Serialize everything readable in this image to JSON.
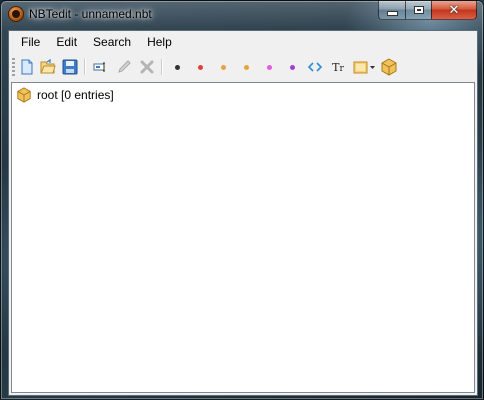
{
  "window": {
    "title": "NBTedit - unnamed.nbt"
  },
  "menu": [
    {
      "label": "File"
    },
    {
      "label": "Edit"
    },
    {
      "label": "Search"
    },
    {
      "label": "Help"
    }
  ],
  "toolbar": {
    "buttons": [
      {
        "icon": "new-file-icon"
      },
      {
        "icon": "open-folder-icon"
      },
      {
        "icon": "save-icon"
      },
      {
        "icon": "rename-icon"
      },
      {
        "icon": "edit-pencil-icon",
        "disabled": true
      },
      {
        "icon": "delete-icon",
        "disabled": true
      },
      {
        "icon": "add-byte-tag-icon",
        "color": "#333333"
      },
      {
        "icon": "add-short-tag-icon",
        "color": "#e0403a"
      },
      {
        "icon": "add-int-tag-icon",
        "color": "#e9a23b"
      },
      {
        "icon": "add-long-tag-icon",
        "color": "#e9a23b"
      },
      {
        "icon": "add-float-tag-icon",
        "color": "#e35de0"
      },
      {
        "icon": "add-double-tag-icon",
        "color": "#a33fd1"
      },
      {
        "icon": "add-byte-array-tag-icon",
        "color": "#2a8fd6"
      },
      {
        "icon": "add-string-tag-icon",
        "label": "Tr"
      },
      {
        "icon": "add-list-tag-icon"
      },
      {
        "icon": "add-compound-tag-icon"
      }
    ]
  },
  "tree": {
    "root": {
      "label": "root [0 entries]",
      "icon": "compound-tag-icon"
    }
  }
}
